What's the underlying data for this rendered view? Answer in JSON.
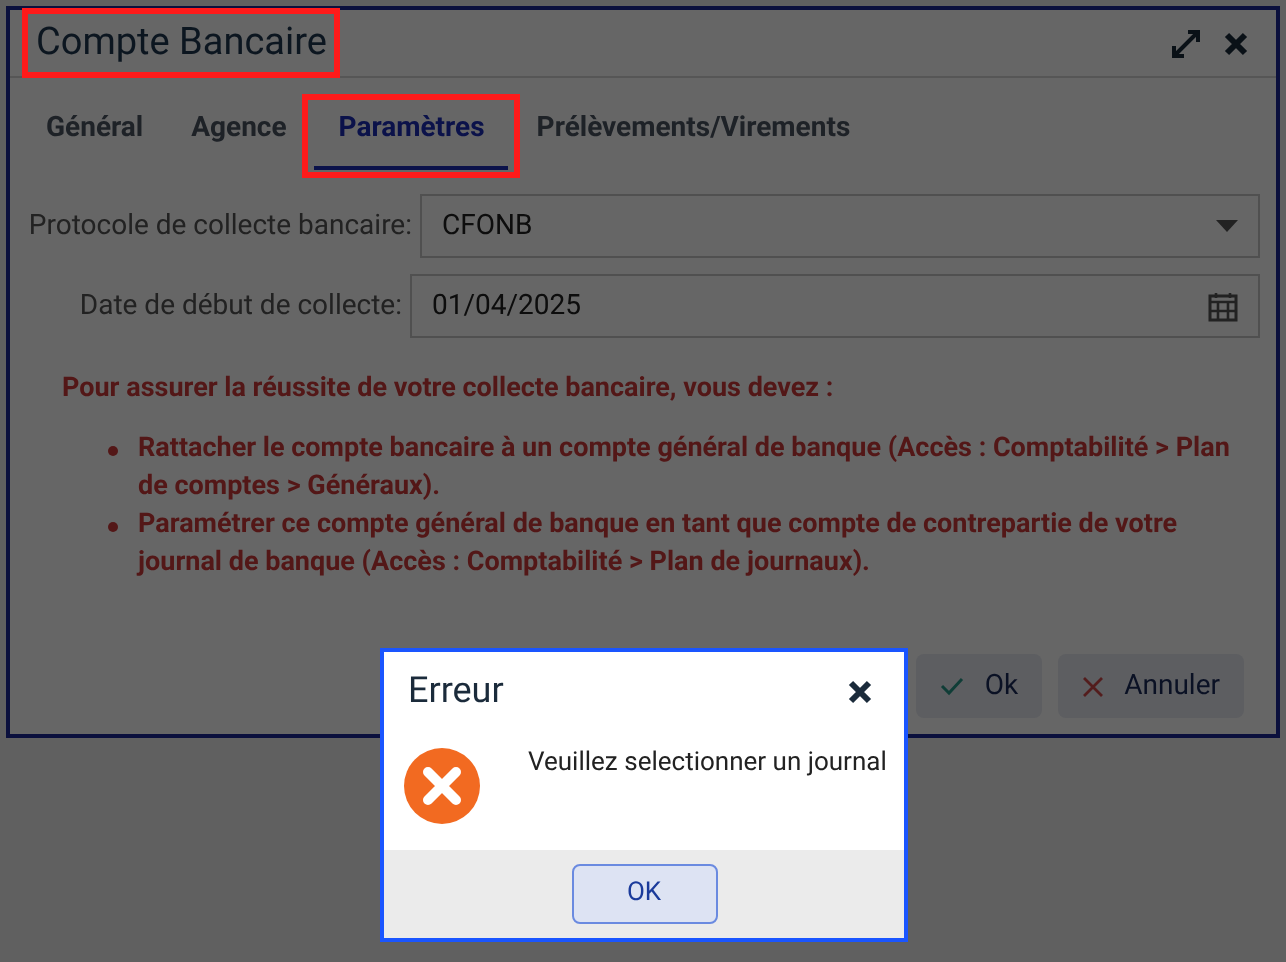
{
  "window": {
    "title": "Compte Bancaire"
  },
  "tabs": [
    {
      "label": "Général",
      "selected": false
    },
    {
      "label": "Agence",
      "selected": false
    },
    {
      "label": "Paramètres",
      "selected": true
    },
    {
      "label": "Prélèvements/Virements",
      "selected": false
    }
  ],
  "fields": [
    {
      "kind": "select",
      "label": "Protocole de collecte bancaire:",
      "value": "CFONB"
    },
    {
      "kind": "date",
      "label": "Date de début de collecte:",
      "value": "01/04/2025"
    }
  ],
  "warning": {
    "intro": "Pour assurer la réussite de votre collecte bancaire, vous devez :",
    "items": [
      "Rattacher le compte bancaire à un compte général de banque (Accès : Comptabilité > Plan de comptes > Généraux).",
      "Paramétrer ce compte général de banque en tant que compte de contrepartie de votre journal de banque (Accès : Comptabilité > Plan de journaux)."
    ]
  },
  "buttons": [
    {
      "kind": "ok",
      "label": "Ok"
    },
    {
      "kind": "cancel",
      "label": "Annuler"
    }
  ],
  "error_dialog": {
    "title": "Erreur",
    "message": "Veuillez selectionner un journal",
    "button": "OK"
  }
}
